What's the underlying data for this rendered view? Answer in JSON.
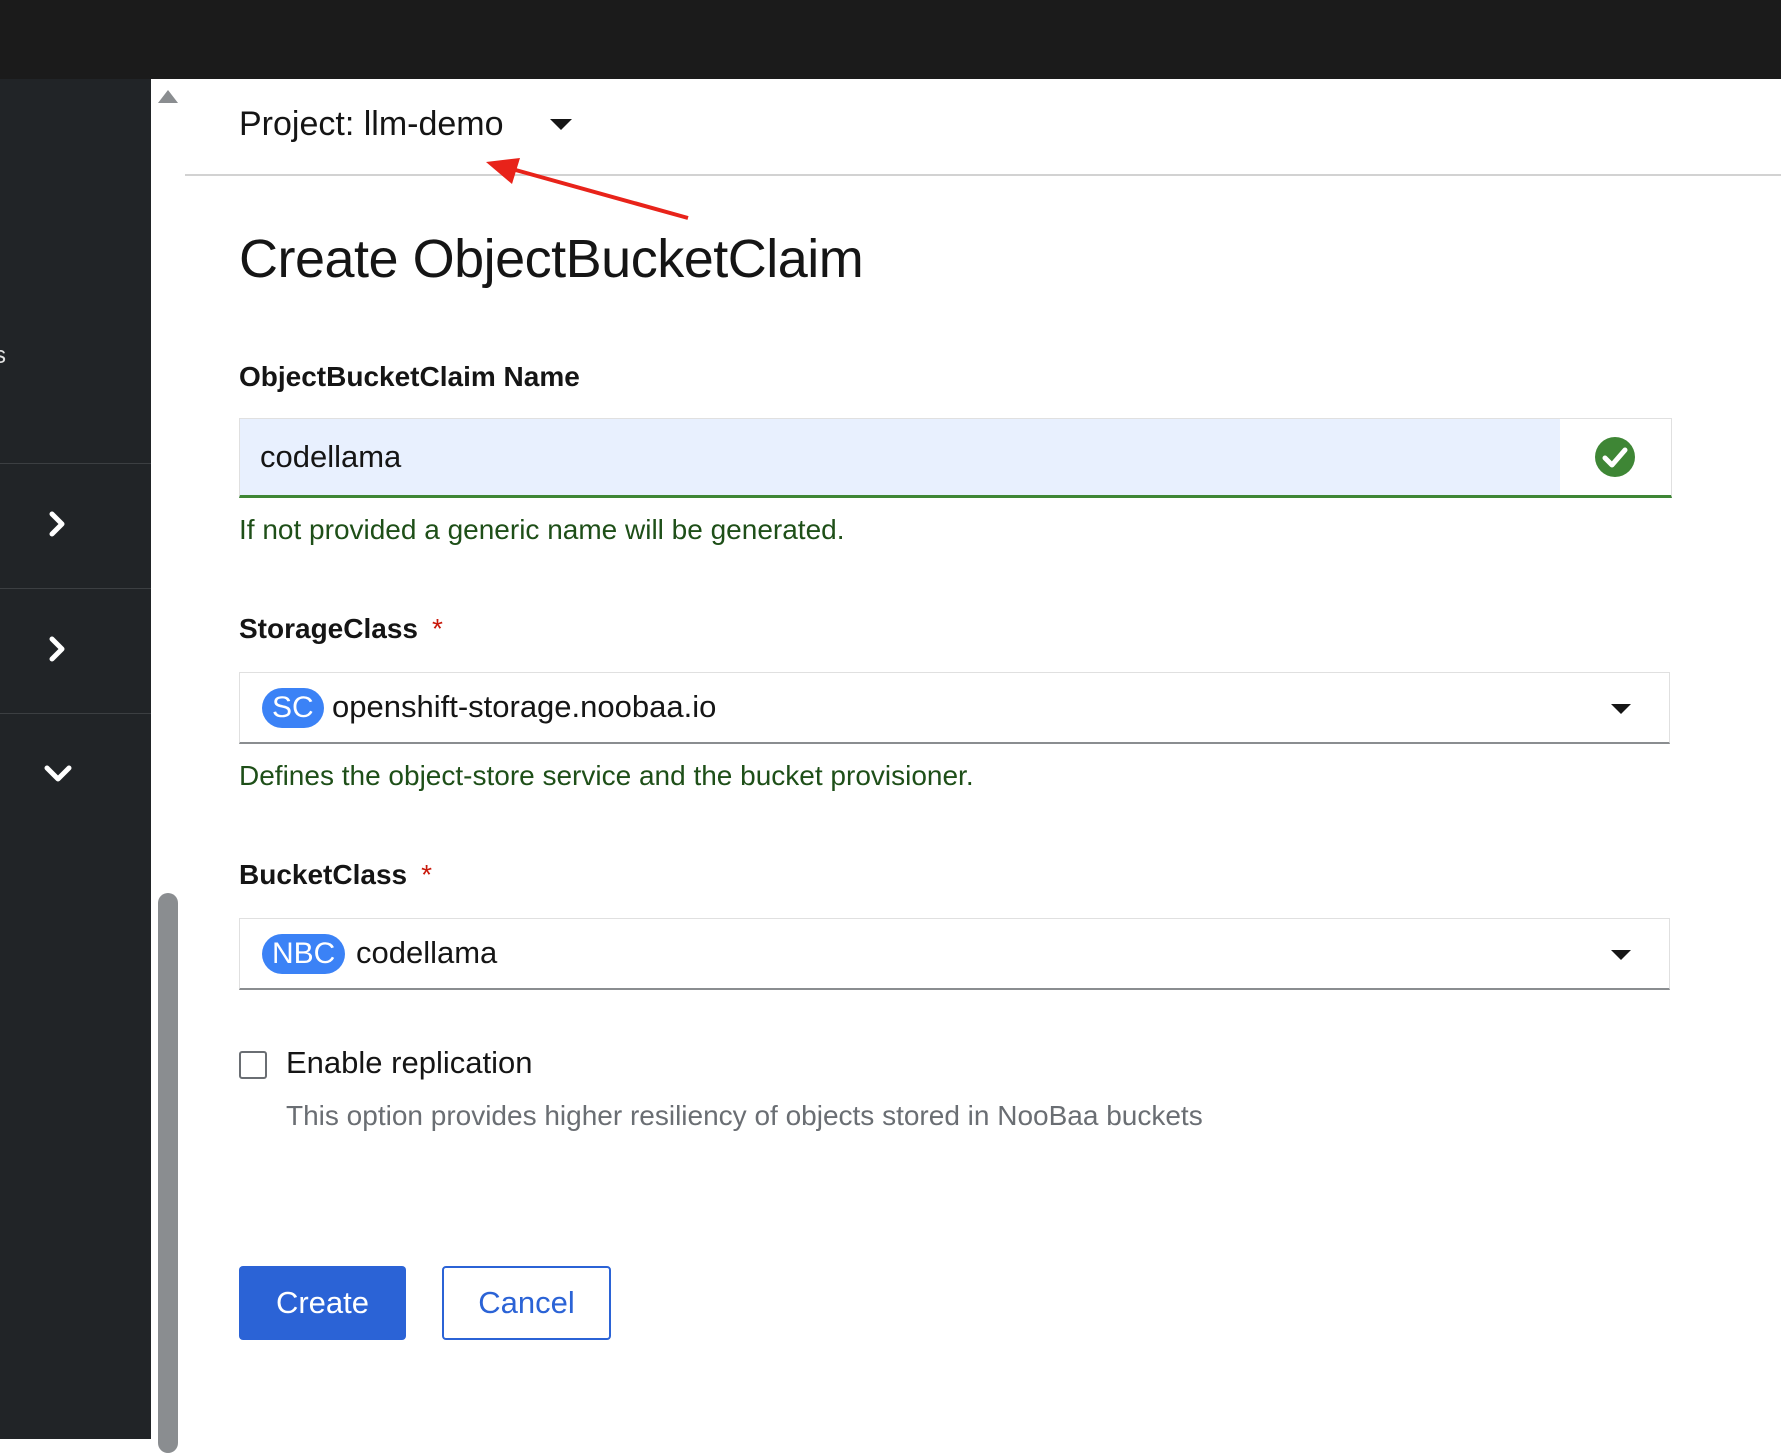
{
  "project": {
    "label": "Project: llm-demo"
  },
  "page": {
    "title": "Create ObjectBucketClaim"
  },
  "form": {
    "name_field": {
      "label": "ObjectBucketClaim Name",
      "value": "codellama",
      "helper": "If not provided a generic name will be generated.",
      "status": "valid"
    },
    "storage_class": {
      "label": "StorageClass",
      "required_mark": "*",
      "badge": "SC",
      "value": "openshift-storage.noobaa.io",
      "helper": "Defines the object-store service and the bucket provisioner."
    },
    "bucket_class": {
      "label": "BucketClass",
      "required_mark": "*",
      "badge": "NBC",
      "value": "codellama"
    },
    "replication": {
      "label": "Enable replication",
      "description": "This option provides higher resiliency of objects stored in NooBaa buckets",
      "checked": false
    }
  },
  "actions": {
    "create_label": "Create",
    "cancel_label": "Cancel"
  },
  "sidebar": {
    "partial_text": "s",
    "toggles": [
      "chevron-right-icon",
      "chevron-right-icon",
      "chevron-down-icon"
    ]
  },
  "colors": {
    "primary": "#2b63d6",
    "success": "#3e8635",
    "required": "#c9190b",
    "badge": "#3b82f6",
    "annotation_arrow": "#e8231a"
  }
}
